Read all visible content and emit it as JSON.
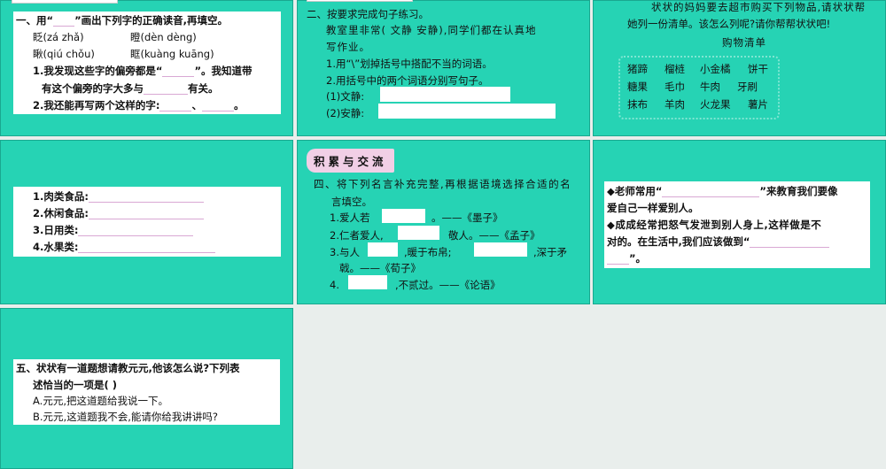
{
  "slide1": {
    "title": "一、用“",
    "title_after": "”画出下列字的正确读音,再填空。",
    "chars": [
      {
        "c": "眨",
        "p": "(zá  zhǎ)"
      },
      {
        "c": "瞪",
        "p": "(dèn  dèng)"
      },
      {
        "c": "瞅",
        "p": "(qiú  chǒu)"
      },
      {
        "c": "眶",
        "p": "(kuàng  kuāng)"
      }
    ],
    "q1a": "1.我发现这些字的偏旁都是“",
    "q1b": "”。我知道带",
    "q1c": "有这个偏旁的字大多与",
    "q1d": "有关。",
    "q2a": "2.我还能再写两个这样的字:",
    "q2b": "、",
    "q2c": "。"
  },
  "slide2": {
    "title": "二、按要求完成句子练习。",
    "s1": "教室里非常(  文静      安静),同学们都在认真地",
    "s2": "写作业。",
    "q1": "1.用“\\”划掉括号中搭配不当的词语。",
    "q2": "2.用括号中的两个词语分别写句子。",
    "a1": "(1)文静:",
    "a2": "(2)安静:"
  },
  "slide3": {
    "intro1": "状状的妈妈要去超市购买下列物品,请状状帮",
    "intro2": "她列一份清单。该怎么列呢?请你帮帮状状吧!",
    "list_title": "购物清单",
    "rows": [
      [
        "猪蹄",
        "榴梿",
        "小金橘",
        "饼干"
      ],
      [
        "糖果",
        "毛巾",
        "牛肉",
        "牙刷"
      ],
      [
        "抹布",
        "羊肉",
        "火龙果",
        "薯片"
      ]
    ]
  },
  "slide4": {
    "items": [
      "1.肉类食品:",
      "2.休闲食品:",
      "3.日用类:",
      "4.水果类:"
    ]
  },
  "slide5": {
    "tag": "积累与交流",
    "title1": "四、将下列名言补充完整,再根据语境选择合适的名",
    "title2": "言填空。",
    "l1a": "1.爱人若",
    "l1b": "。——《墨子》",
    "l2a": "2.仁者爱人,",
    "l2b": "敬人。——《孟子》",
    "l3a": "3.与人",
    "l3b": ",暖于布帛;",
    "l3c": ",深于矛",
    "l3d": "戟。——《荀子》",
    "l4a": "4.",
    "l4b": ",不贰过。——《论语》"
  },
  "slide6": {
    "p1a": "◆老师常用“",
    "p1b": "”来教育我们要像",
    "p1c": "爱自己一样爱别人。",
    "p2a": "◆成成经常把怒气发泄到别人身上,这样做是不",
    "p2b": "对的。在生活中,我们应该做到“",
    "p2c": "”。"
  },
  "slide7": {
    "q1": "五、状状有一道题想请教元元,他该怎么说?下列表",
    "q2": "述恰当的一项是(     )",
    "a": "A.元元,把这道题给我说一下。",
    "b": "B.元元,这道题我不会,能请你给我讲讲吗?"
  }
}
